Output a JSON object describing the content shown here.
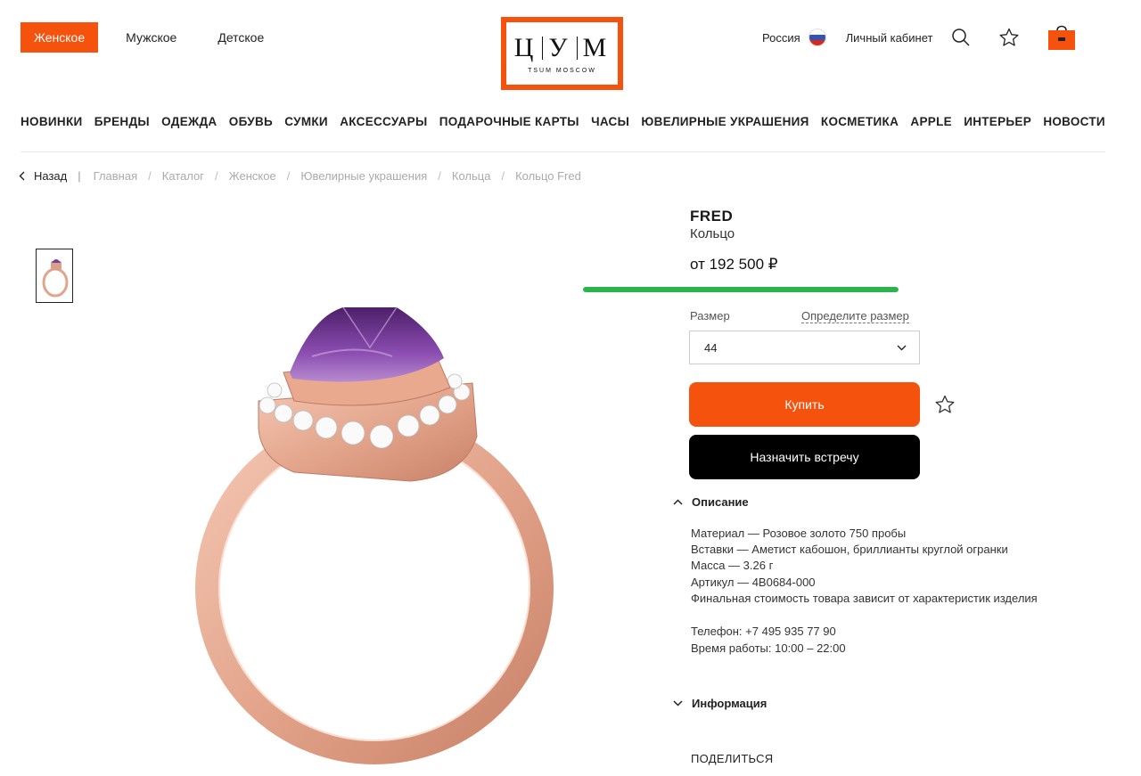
{
  "header": {
    "gender_tabs": [
      "Женское",
      "Мужское",
      "Детское"
    ],
    "logo": {
      "main": [
        "Ц",
        "У",
        "М"
      ],
      "sub": "TSUM MOSCOW"
    },
    "region": "Россия",
    "account": "Личный кабинет",
    "icons": [
      "search-icon",
      "star-icon",
      "cart-icon"
    ]
  },
  "nav": [
    "НОВИНКИ",
    "БРЕНДЫ",
    "ОДЕЖДА",
    "ОБУВЬ",
    "СУМКИ",
    "АКСЕССУАРЫ",
    "ПОДАРОЧНЫЕ КАРТЫ",
    "ЧАСЫ",
    "ЮВЕЛИРНЫЕ УКРАШЕНИЯ",
    "КОСМЕТИКА",
    "APPLE",
    "ИНТЕРЬЕР",
    "НОВОСТИ"
  ],
  "breadcrumb": {
    "back": "Назад",
    "items": [
      "Главная",
      "Каталог",
      "Женское",
      "Ювелирные украшения",
      "Кольца",
      "Кольцо Fred"
    ]
  },
  "product": {
    "brand": "FRED",
    "type": "Кольцо",
    "price": "от 192 500 ₽",
    "progress": 1.0,
    "size_label": "Размер",
    "size_link": "Определите размер",
    "size_value": "44",
    "buy_label": "Купить",
    "meet_label": "Назначить встречу"
  },
  "description": {
    "title": "Описание",
    "lines": [
      "Материал — Розовое золото 750 пробы",
      "Вставки — Аметист кабошон, бриллианты круглой огранки",
      "Масса — 3.26 г",
      "Артикул — 4B0684-000",
      "Финальная стоимость товара зависит от характеристик изделия"
    ],
    "phone": "Телефон: +7 495 935 77 90",
    "hours": "Время работы: 10:00 – 22:00"
  },
  "info_title": "Информация",
  "share_label": "ПОДЕЛИТЬСЯ",
  "colors": {
    "accent": "#f5520e",
    "progress": "#2bb34c"
  }
}
